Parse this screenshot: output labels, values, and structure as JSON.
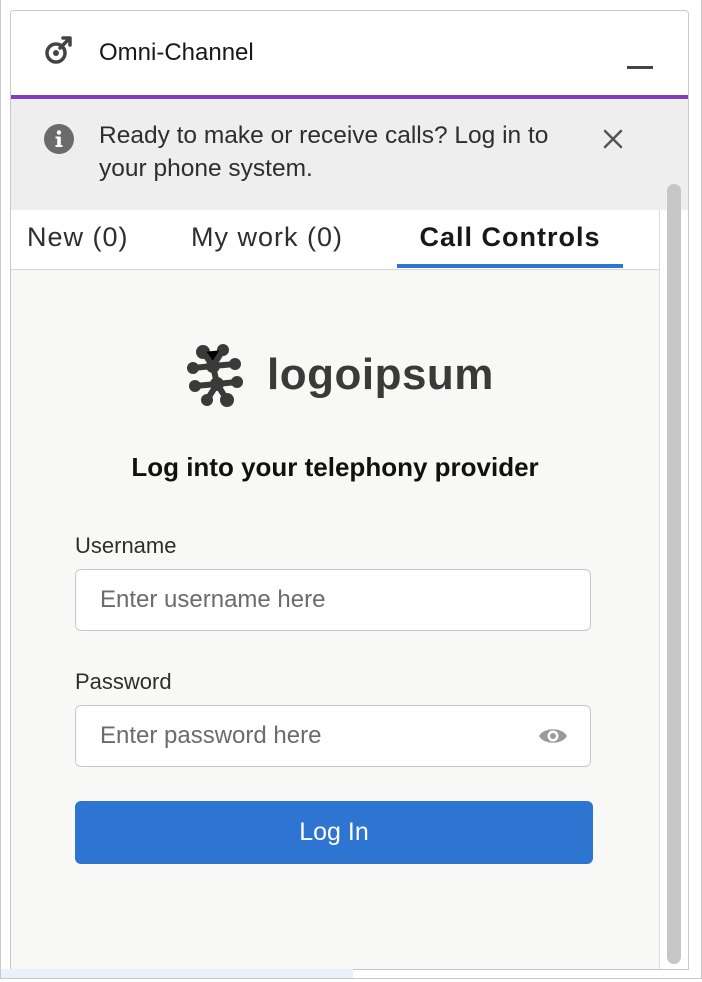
{
  "header": {
    "title": "Omni-Channel",
    "icon": "omni-channel-icon",
    "minimize_icon": "minimize-icon"
  },
  "banner": {
    "icon": "info-icon",
    "text": "Ready to make or receive calls? Log in to your phone system.",
    "close_icon": "close-icon"
  },
  "tabs": [
    {
      "label": "New (0)",
      "selected": false
    },
    {
      "label": "My work (0)",
      "selected": false
    },
    {
      "label": "Call Controls",
      "selected": true
    }
  ],
  "login": {
    "logo_text": "logoipsum",
    "title": "Log into your telephony provider",
    "username_label": "Username",
    "username_placeholder": "Enter username here",
    "username_value": "",
    "password_label": "Password",
    "password_placeholder": "Enter password here",
    "password_value": "",
    "button_label": "Log In"
  },
  "colors": {
    "accent_purple": "#7f3fbf",
    "primary_blue": "#2e74d1",
    "logo_gray": "#3a3a3a"
  }
}
